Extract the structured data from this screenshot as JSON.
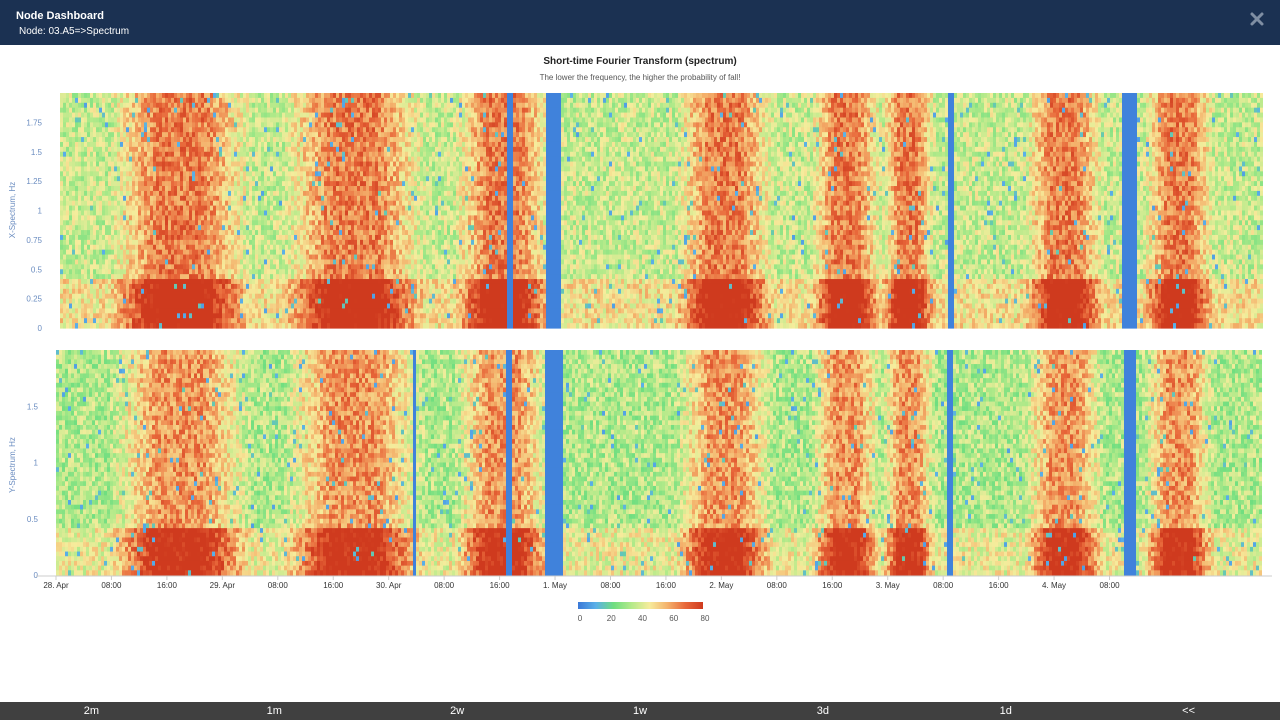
{
  "header": {
    "title": "Node Dashboard",
    "subtitle": "Node: 03.A5=>Spectrum",
    "close_icon": "close-icon"
  },
  "footer": {
    "buttons": [
      "2m",
      "1m",
      "2w",
      "1w",
      "3d",
      "1d",
      "<<"
    ]
  },
  "chart_data": {
    "type": "heatmap",
    "title": "Short-time Fourier Transform (spectrum)",
    "subtitle": "The lower the frequency, the higher the probability of fall!",
    "x_tick_labels": [
      "28. Apr",
      "08:00",
      "16:00",
      "29. Apr",
      "08:00",
      "16:00",
      "30. Apr",
      "08:00",
      "16:00",
      "1. May",
      "08:00",
      "16:00",
      "2. May",
      "08:00",
      "16:00",
      "3. May",
      "08:00",
      "16:00",
      "4. May",
      "08:00"
    ],
    "x_range_hours": [
      0,
      174
    ],
    "panels": [
      {
        "ylabel": "X-Spectrum, Hz",
        "ylim": [
          0,
          2
        ],
        "y_ticks": [
          0,
          0.25,
          0.5,
          0.75,
          1,
          1.25,
          1.5,
          1.75
        ],
        "y_tick_labels": [
          "0",
          "0.25",
          "0.5",
          "0.75",
          "1",
          "1.25",
          "1.5",
          "1.75"
        ]
      },
      {
        "ylabel": "Y-Spectrum, Hz",
        "ylim": [
          0,
          2
        ],
        "y_ticks": [
          0,
          0.5,
          1,
          1.5
        ],
        "y_tick_labels": [
          "0",
          "0.5",
          "1",
          "1.5"
        ]
      }
    ],
    "high_intensity_bands_hours": [
      [
        10,
        26
      ],
      [
        35,
        51
      ],
      [
        59,
        70
      ],
      [
        91,
        102
      ],
      [
        110,
        118
      ],
      [
        120,
        126
      ],
      [
        141,
        150
      ],
      [
        158,
        166
      ]
    ],
    "gap_bands_hours": [
      [
        51.5,
        51.8
      ],
      [
        65,
        66
      ],
      [
        70.5,
        73
      ],
      [
        128.5,
        129.5
      ],
      [
        154,
        156
      ]
    ],
    "colorbar": {
      "min": 0,
      "max": 80,
      "tick_labels": [
        "0",
        "20",
        "40",
        "60",
        "80"
      ],
      "colors": [
        "#3a78d8",
        "#5ab0e8",
        "#6fde80",
        "#b4ea8a",
        "#f6ec9c",
        "#f4b26c",
        "#e8683a",
        "#cf3a1e"
      ]
    }
  }
}
